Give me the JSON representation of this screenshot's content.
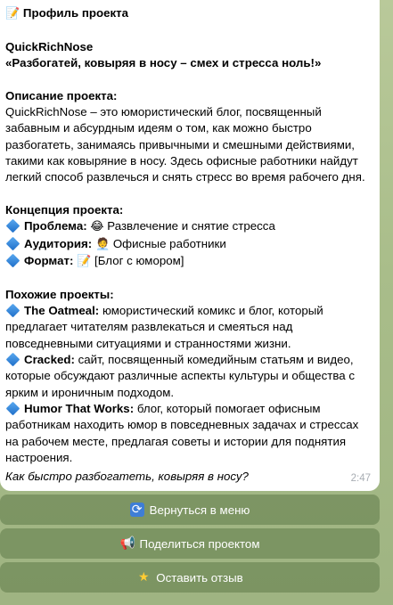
{
  "message": {
    "header": "Профиль проекта",
    "header_icon": "memo-icon",
    "name": "QuickRichNose",
    "slogan": "«Разбогатей, ковыряя в носу – смех и стресса ноль!»",
    "desc_title": "Описание проекта:",
    "desc_lines": [
      "QuickRichNose – это юмористический блог, посвященный",
      "забавным и абсурдным идеям о том, как можно быстро",
      "разбогатеть, занимаясь привычными и смешными действиями,",
      "такими как ковыряние в носу. Здесь офисные работники найдут",
      "легкий способ развлечься и снять стресс во время рабочего дня."
    ],
    "concept_title": "Концепция проекта:",
    "concept": [
      {
        "label": "Проблема:",
        "icon_name": "laughing-emoji-icon",
        "icon": "😂",
        "text": "Развлечение и снятие стресса"
      },
      {
        "label": "Аудитория:",
        "icon_name": "office-worker-emoji-icon",
        "icon": "🧑‍💼",
        "text": "Офисные работники"
      },
      {
        "label": "Формат:",
        "icon_name": "memo-emoji-icon",
        "icon": "📝",
        "text": "[Блог с юмором]"
      }
    ],
    "similar_title": "Похожие проекты:",
    "similar": [
      {
        "name": "The Oatmeal:",
        "lines": [
          "юмористический комикс и блог, который",
          "предлагает читателям развлекаться и смеяться над",
          "повседневными ситуациями и странностями жизни."
        ]
      },
      {
        "name": "Cracked:",
        "lines": [
          "сайт, посвященный комедийным статьям и видео,",
          "которые обсуждают различные аспекты культуры и общества с",
          "ярким и ироничным подходом."
        ]
      },
      {
        "name": "Humor That Works:",
        "lines": [
          "блог, который помогает офисным",
          "работникам находить юмор в повседневных задачах и стрессах",
          "на рабочем месте, предлагая советы и истории для поднятия",
          "настроения."
        ]
      }
    ],
    "footer": "Как быстро разбогатеть, ковыряя в носу?",
    "time": "2:47"
  },
  "buttons": [
    {
      "label": "Вернуться в меню",
      "icon": "refresh-icon"
    },
    {
      "label": "Поделиться проектом",
      "icon": "megaphone-icon"
    },
    {
      "label": "Оставить отзыв",
      "icon": "star-icon"
    }
  ]
}
